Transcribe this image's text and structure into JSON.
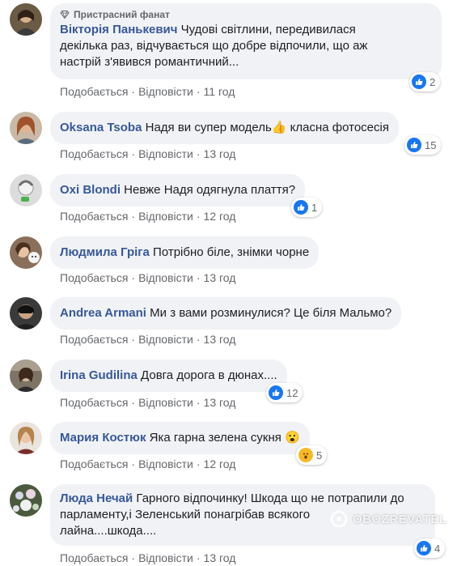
{
  "watermark": {
    "text": "OBOZREVATEL"
  },
  "actions": {
    "like": "Подобається",
    "reply": "Відповісти",
    "separator": "·"
  },
  "comments": [
    {
      "badge": "Пристрасний фанат",
      "author": "Вікторія Панькевич",
      "line1": "Чудові світлини, передивилася",
      "line2": "декілька раз, відчувається що добре відпочили, що аж",
      "line3": "настрій з'явився романтичний...",
      "time": "11 год",
      "reactions": "2",
      "reaction_type": "like"
    },
    {
      "author": "Oksana Tsoba",
      "text": "Надя ви супер модель👍 класна фотосесія",
      "time": "13 год",
      "reactions": "15",
      "reaction_type": "like"
    },
    {
      "author": "Oxi Blondi",
      "text": "Невже Надя одягнула плаття?",
      "time": "12 год",
      "reactions": "1",
      "reaction_type": "like"
    },
    {
      "author": "Людмила Гріга",
      "text": "Потрібно біле, знімки чорне",
      "time": "13 год"
    },
    {
      "author": "Andrea Armani",
      "text": "Ми з вами розминулися? Це біля Мальмо?",
      "time": "13 год"
    },
    {
      "author": "Irina Gudilina",
      "text": "Довга дорога в дюнах....",
      "time": "13 год",
      "reactions": "12",
      "reaction_type": "like"
    },
    {
      "author": "Мария Костюк",
      "text": "Яка гарна зелена сукня 😮",
      "time": "12 год",
      "reactions": "5",
      "reaction_type": "wow"
    },
    {
      "author": "Люда Нечай",
      "line1": "Гарного відпочинку! Шкода що не потрапили до",
      "line2": "парламенту,і Зеленський понагрібав всякого",
      "line3": "лайна....шкода....",
      "time": "13 год",
      "reactions": "4",
      "reaction_type": "like"
    }
  ]
}
